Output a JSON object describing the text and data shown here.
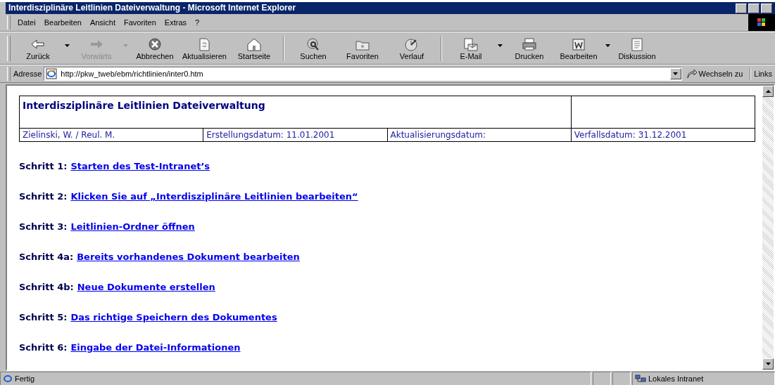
{
  "window": {
    "title": "Interdisziplinäre Leitlinien Dateiverwaltung - Microsoft Internet Explorer"
  },
  "menu": [
    "Datei",
    "Bearbeiten",
    "Ansicht",
    "Favoriten",
    "Extras",
    "?"
  ],
  "toolbar": [
    {
      "label": "Zurück",
      "disabled": false,
      "dropdown": true,
      "separator_before": false
    },
    {
      "label": "Vorwärts",
      "disabled": true,
      "dropdown": true,
      "separator_before": false
    },
    {
      "label": "Abbrechen",
      "disabled": false,
      "dropdown": false,
      "separator_before": false
    },
    {
      "label": "Aktualisieren",
      "disabled": false,
      "dropdown": false,
      "separator_before": false
    },
    {
      "label": "Startseite",
      "disabled": false,
      "dropdown": false,
      "separator_before": false
    },
    {
      "label": "Suchen",
      "disabled": false,
      "dropdown": false,
      "separator_before": true
    },
    {
      "label": "Favoriten",
      "disabled": false,
      "dropdown": false,
      "separator_before": false
    },
    {
      "label": "Verlauf",
      "disabled": false,
      "dropdown": false,
      "separator_before": false
    },
    {
      "label": "E-Mail",
      "disabled": false,
      "dropdown": true,
      "separator_before": true
    },
    {
      "label": "Drucken",
      "disabled": false,
      "dropdown": false,
      "separator_before": false
    },
    {
      "label": "Bearbeiten",
      "disabled": false,
      "dropdown": true,
      "separator_before": false
    },
    {
      "label": "Diskussion",
      "disabled": false,
      "dropdown": false,
      "separator_before": false
    }
  ],
  "address_bar": {
    "label": "Adresse",
    "value": "http://pkw_tweb/ebm/richtlinien/inter0.htm",
    "go_button": "Wechseln zu",
    "links": "Links"
  },
  "document": {
    "title": "Interdisziplinäre Leitlinien Dateiverwaltung",
    "meta": [
      "Zielinski, W. / Reul. M.",
      "Erstellungsdatum: 11.01.2001",
      "Aktualisierungsdatum:",
      "Verfallsdatum: 31.12.2001"
    ],
    "steps": [
      {
        "label": "Schritt 1:",
        "link": "Starten des Test-Intranet’s"
      },
      {
        "label": "Schritt 2:",
        "link": "Klicken Sie auf „Interdisziplinäre Leitlinien bearbeiten“"
      },
      {
        "label": "Schritt 3:",
        "link": "Leitlinien-Ordner öffnen"
      },
      {
        "label": "Schritt 4a:",
        "link": "Bereits vorhandenes Dokument bearbeiten"
      },
      {
        "label": "Schritt 4b:",
        "link": "Neue Dokumente erstellen"
      },
      {
        "label": "Schritt 5:",
        "link": "Das richtige Speichern des Dokumentes"
      },
      {
        "label": "Schritt 6:",
        "link": "Eingabe der Datei-Informationen"
      }
    ]
  },
  "status_bar": {
    "text": "Fertig",
    "zone": "Lokales Intranet"
  }
}
